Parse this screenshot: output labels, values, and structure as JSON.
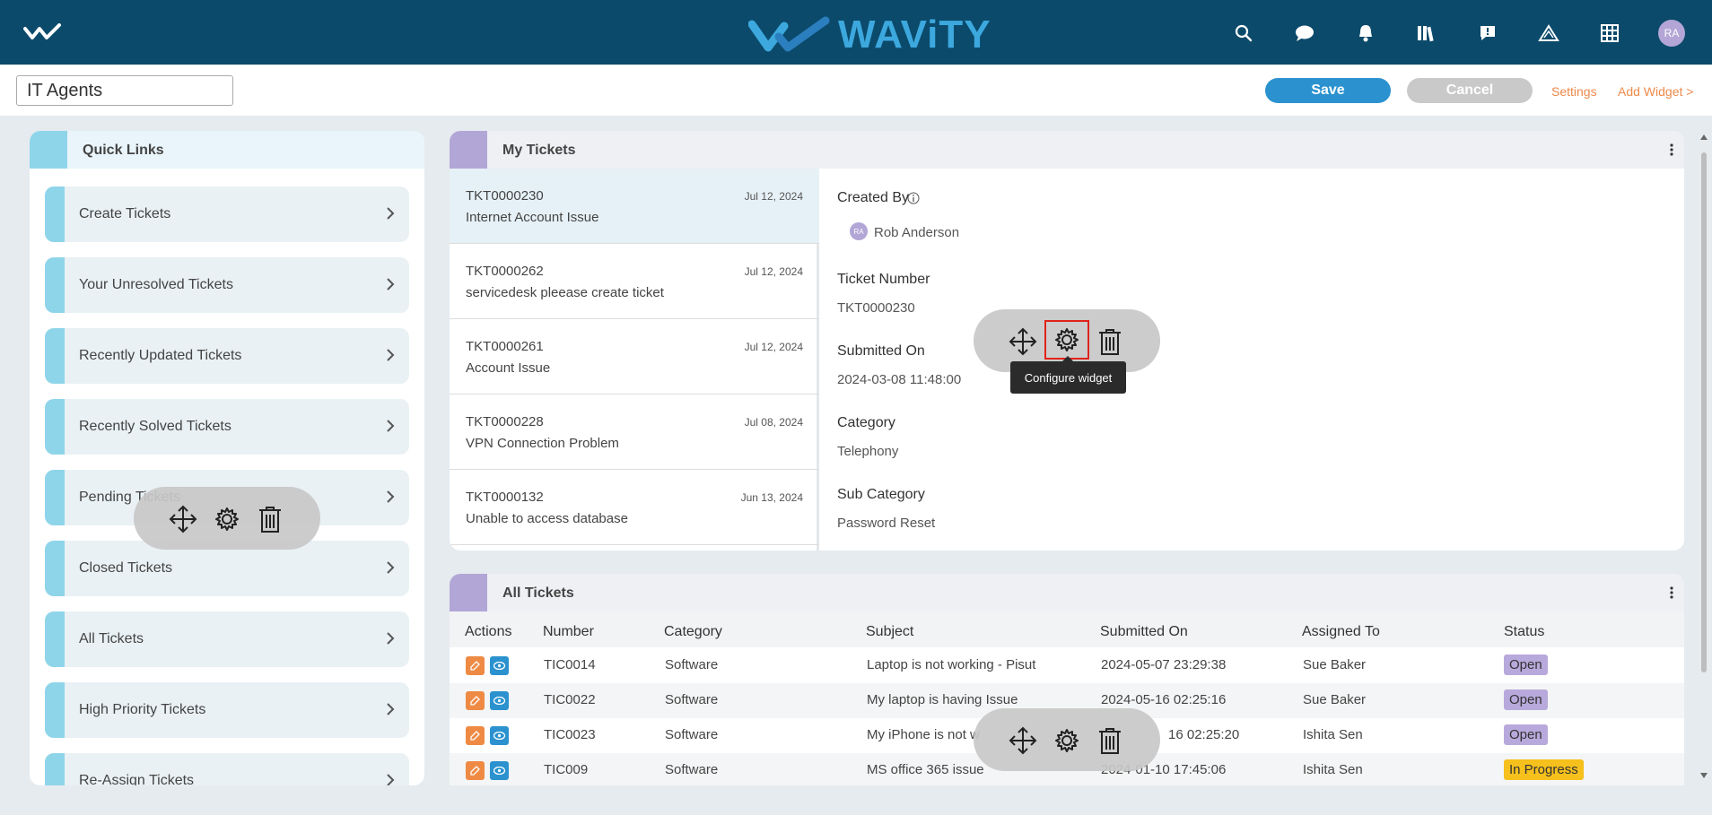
{
  "topbar": {
    "brand": "WAViTY",
    "avatar": "RA",
    "icons": [
      "search-icon",
      "chat-icon",
      "bell-icon",
      "library-icon",
      "feedback-icon",
      "alert-icon",
      "grid-icon"
    ]
  },
  "subbar": {
    "page_name": "IT Agents",
    "save": "Save",
    "cancel": "Cancel",
    "settings": "Settings",
    "add_widget": "Add Widget >"
  },
  "quick_links": {
    "title": "Quick Links",
    "items": [
      {
        "label": "Create Tickets"
      },
      {
        "label": "Your Unresolved Tickets"
      },
      {
        "label": "Recently Updated Tickets"
      },
      {
        "label": "Recently Solved Tickets"
      },
      {
        "label": "Pending Tickets"
      },
      {
        "label": "Closed Tickets"
      },
      {
        "label": "All Tickets"
      },
      {
        "label": "High Priority Tickets"
      },
      {
        "label": "Re-Assign Tickets"
      }
    ]
  },
  "my_tickets": {
    "title": "My Tickets",
    "tickets": [
      {
        "number": "TKT0000230",
        "date": "Jul 12, 2024",
        "subject": "Internet Account Issue"
      },
      {
        "number": "TKT0000262",
        "date": "Jul 12, 2024",
        "subject": "servicedesk pleease create ticket"
      },
      {
        "number": "TKT0000261",
        "date": "Jul 12, 2024",
        "subject": "Account Issue"
      },
      {
        "number": "TKT0000228",
        "date": "Jul 08, 2024",
        "subject": "VPN Connection Problem"
      },
      {
        "number": "TKT0000132",
        "date": "Jun 13, 2024",
        "subject": "Unable to access database"
      }
    ],
    "detail": {
      "created_by_label": "Created By",
      "created_by_initials": "RA",
      "created_by": "Rob Anderson",
      "ticket_number_label": "Ticket Number",
      "ticket_number": "TKT0000230",
      "submitted_on_label": "Submitted On",
      "submitted_on": "2024-03-08 11:48:00",
      "category_label": "Category",
      "category": "Telephony",
      "sub_category_label": "Sub Category",
      "sub_category": "Password Reset"
    }
  },
  "all_tickets": {
    "title": "All Tickets",
    "columns": [
      "Actions",
      "Number",
      "Category",
      "Subject",
      "Submitted On",
      "Assigned To",
      "Status"
    ],
    "rows": [
      {
        "number": "TIC0014",
        "category": "Software",
        "subject": "Laptop is not working - Pisut",
        "submitted": "2024-05-07 23:29:38",
        "assigned": "Sue Baker",
        "status": "Open"
      },
      {
        "number": "TIC0022",
        "category": "Software",
        "subject": "My laptop is having Issue",
        "submitted": "2024-05-16 02:25:16",
        "assigned": "Sue Baker",
        "status": "Open"
      },
      {
        "number": "TIC0023",
        "category": "Software",
        "subject": "My iPhone is not w",
        "submitted": "16 02:25:20",
        "assigned": "Ishita Sen",
        "status": "Open"
      },
      {
        "number": "TIC009",
        "category": "Software",
        "subject": "MS office 365 issue",
        "submitted": "2024-01-10 17:45:06",
        "assigned": "Ishita Sen",
        "status": "In Progress"
      }
    ]
  },
  "tooltip": "Configure widget",
  "colors": {
    "topbar": "#0b4a6b",
    "accent_blue": "#2b92cf",
    "orange": "#ee8a44",
    "purple": "#b2a6d6",
    "cyan": "#8fd5ea"
  }
}
